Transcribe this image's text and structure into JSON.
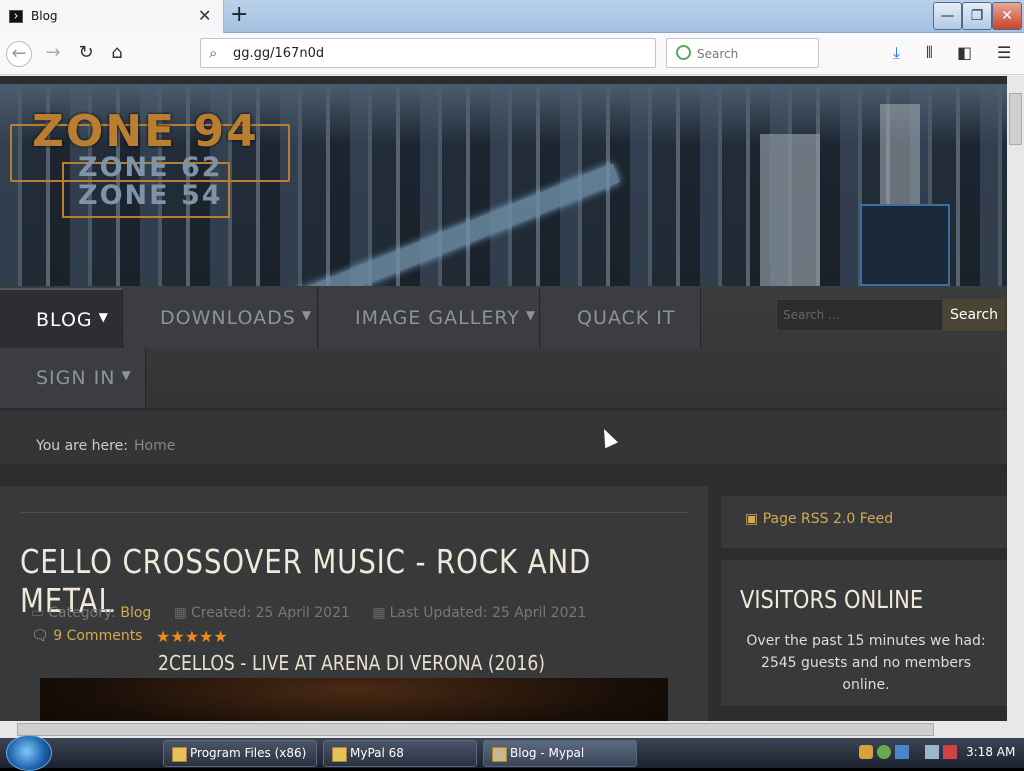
{
  "browser": {
    "tab_title": "Blog",
    "close_glyph": "✕",
    "new_tab_glyph": "+",
    "url": "gg.gg/167n0d",
    "search_placeholder": "Search",
    "window_buttons": {
      "minimize": "—",
      "maximize": "❐",
      "close": "✕"
    }
  },
  "site": {
    "logo": {
      "primary": "ZONE 94",
      "secondary": [
        "ZONE 62",
        "ZONE 54"
      ]
    },
    "menu": [
      {
        "label": "BLOG",
        "dropdown": true
      },
      {
        "label": "DOWNLOADS",
        "dropdown": true
      },
      {
        "label": "IMAGE GALLERY",
        "dropdown": true
      },
      {
        "label": "QUACK IT",
        "dropdown": false
      },
      {
        "label": "SIGN IN",
        "dropdown": true
      }
    ],
    "search": {
      "placeholder": "Search ...",
      "button": "Search"
    },
    "breadcrumb": {
      "label": "You are here:",
      "current": "Home"
    }
  },
  "article": {
    "title": "CELLO CROSSOVER MUSIC - ROCK AND METAL",
    "category_label": "Category:",
    "category": "Blog",
    "created": "Created: 25 April 2021",
    "updated": "Last Updated: 25 April 2021",
    "comments": "9 Comments",
    "rating_stars": 5,
    "video_title": "2CELLOS - LIVE AT ARENA DI VERONA (2016)"
  },
  "sidebar": {
    "rss": "Page RSS 2.0 Feed",
    "visitors_heading": "VISITORS ONLINE",
    "visitors_text": "Over the past 15 minutes we had: 2545 guests and no members online."
  },
  "taskbar": {
    "items": [
      "Program Files (x86)",
      "MyPal 68",
      "Blog - Mypal"
    ],
    "clock": "3:18 AM"
  },
  "colors": {
    "accent": "#d4aa52",
    "menu_bg": "#3b3d40",
    "page_bg": "#2b2d2e",
    "stars": "#f08a1d"
  }
}
